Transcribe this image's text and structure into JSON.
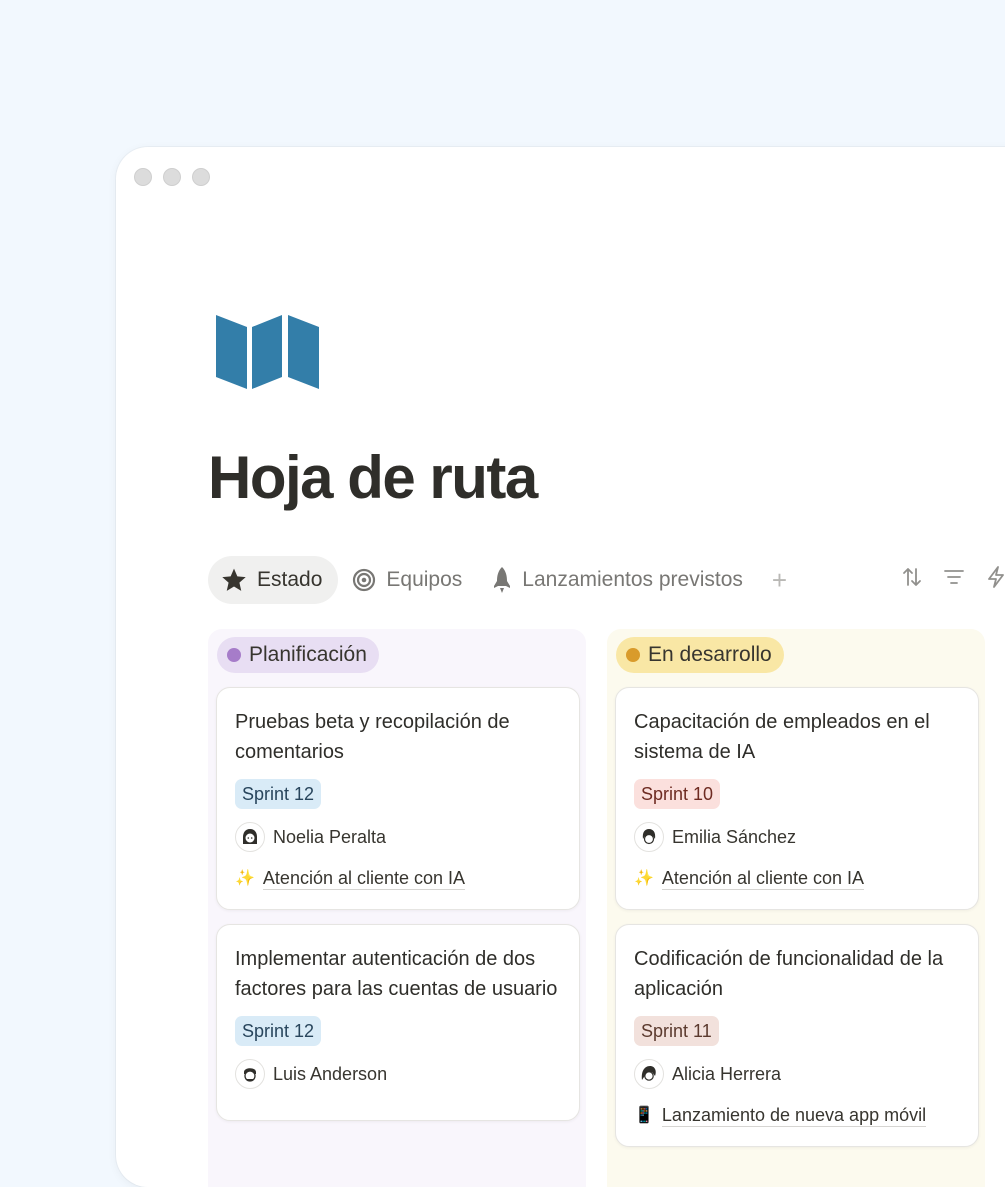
{
  "page": {
    "title": "Hoja de ruta",
    "icon": "map-icon",
    "icon_color": "#337ea9"
  },
  "tabs": [
    {
      "label": "Estado",
      "icon": "star-icon",
      "active": true
    },
    {
      "label": "Equipos",
      "icon": "target-icon",
      "active": false
    },
    {
      "label": "Lanzamientos previstos",
      "icon": "rocket-icon",
      "active": false
    }
  ],
  "toolbar": {
    "icons": [
      "sort-icon",
      "filter-icon",
      "lightning-icon"
    ]
  },
  "columns": [
    {
      "label": "Planificación",
      "color": "#a67cc9",
      "cards": [
        {
          "title": "Pruebas beta y recopilación de comentarios",
          "tag": "Sprint 12",
          "person": "Noelia Peralta",
          "relation": "Atención al cliente con IA"
        },
        {
          "title": "Implementar autenticación de dos factores para las cuentas de usuario",
          "tag": "Sprint 12",
          "person": "Luis Anderson"
        }
      ]
    },
    {
      "label": "En desarrollo",
      "color": "#d99b2b",
      "cards": [
        {
          "title": "Capacitación de empleados en el sistema de IA",
          "tag": "Sprint 10",
          "person": "Emilia Sánchez",
          "relation": "Atención al cliente con IA"
        },
        {
          "title": "Codificación de funcionalidad de la aplicación",
          "tag": "Sprint 11",
          "person": "Alicia Herrera",
          "relation": "Lanzamiento de nueva app móvil"
        }
      ]
    }
  ],
  "colors": {
    "background": "#f2f8fe",
    "window": "#ffffff"
  }
}
